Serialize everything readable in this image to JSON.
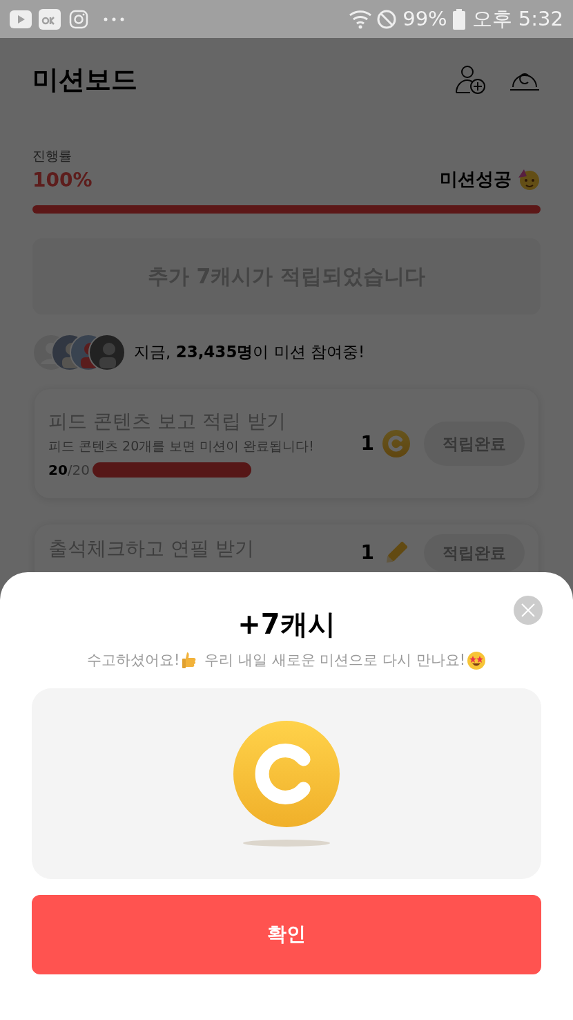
{
  "status_bar": {
    "battery": "99%",
    "time": "오후 5:32"
  },
  "header": {
    "title": "미션보드"
  },
  "progress": {
    "label": "진행률",
    "percent": "100%",
    "level": 1,
    "result": "미션성공"
  },
  "banner": {
    "text": "추가 7캐시가 적립되었습니다"
  },
  "participants": {
    "text": "지금, **23,435명**이 미션 참여중!"
  },
  "missions": [
    {
      "title": "피드 콘텐츠 보고 적립 받기",
      "description": "피드 콘텐츠 20개를 보면 미션이 완료됩니다!",
      "progress_text": "**20**/20",
      "level": 1,
      "reward": {
        "kind": "coin",
        "amount": "1"
      },
      "button": "적립완료",
      "disabled": true
    },
    {
      "title": "출석체크하고 연필 받기",
      "reward": {
        "kind": "pencil",
        "amount": "1"
      },
      "button": "적립완료",
      "disabled": true
    }
  ],
  "sheet": {
    "title": "+7캐시",
    "message_parts": [
      "수고하셨어요!",
      "우리 내일 새로운 미션으로 다시 만나요!"
    ],
    "confirm": "확인"
  }
}
